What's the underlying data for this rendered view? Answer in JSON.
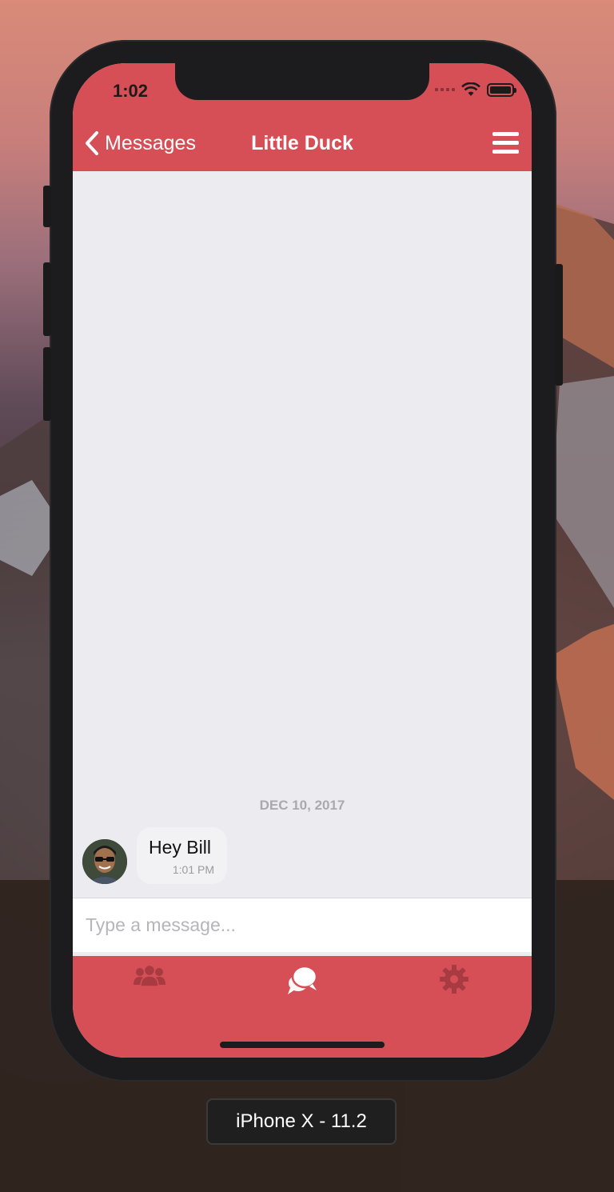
{
  "status_bar": {
    "time": "1:02"
  },
  "nav": {
    "back_label": "Messages",
    "title": "Little Duck"
  },
  "conversation": {
    "date_separator": "DEC 10, 2017",
    "messages": [
      {
        "text": "Hey Bill",
        "time": "1:01 PM"
      }
    ]
  },
  "composer": {
    "placeholder": "Type a message..."
  },
  "tabs": [
    {
      "icon": "people-icon",
      "active": false
    },
    {
      "icon": "chat-bubbles-icon",
      "active": true
    },
    {
      "icon": "gear-icon",
      "active": false
    }
  ],
  "simulator": {
    "device_label": "iPhone X - 11.2"
  },
  "colors": {
    "accent": "#d64f57",
    "chat_background": "#ebebf0",
    "bubble": "#f2f2f5",
    "tab_inactive": "#a83a41",
    "tab_active": "#ffffff"
  }
}
